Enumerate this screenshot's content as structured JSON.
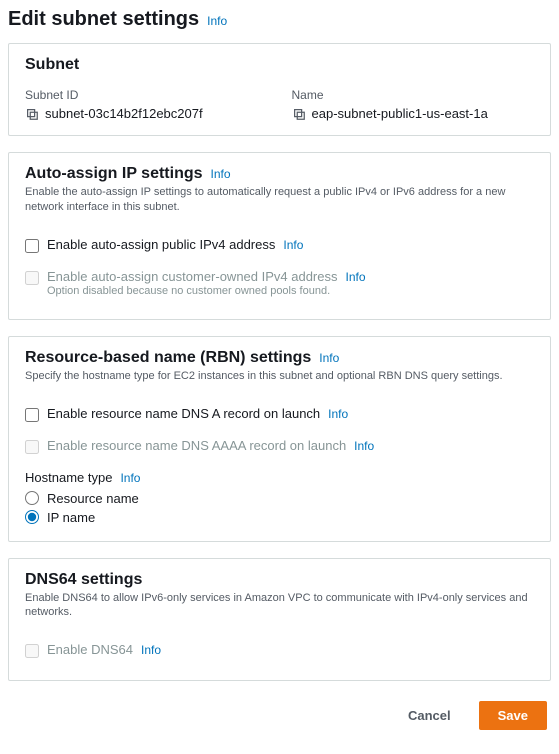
{
  "page": {
    "title": "Edit subnet settings",
    "info": "Info"
  },
  "subnet_panel": {
    "title": "Subnet",
    "fields": {
      "id": {
        "label": "Subnet ID",
        "value": "subnet-03c14b2f12ebc207f"
      },
      "name": {
        "label": "Name",
        "value": "eap-subnet-public1-us-east-1a"
      }
    }
  },
  "auto_assign": {
    "title": "Auto-assign IP settings",
    "info": "Info",
    "desc": "Enable the auto-assign IP settings to automatically request a public IPv4 or IPv6 address for a new network interface in this subnet.",
    "public_ipv4": {
      "label": "Enable auto-assign public IPv4 address",
      "info": "Info",
      "checked": false,
      "disabled": false
    },
    "customer_owned": {
      "label": "Enable auto-assign customer-owned IPv4 address",
      "info": "Info",
      "checked": false,
      "disabled": true,
      "helper": "Option disabled because no customer owned pools found."
    }
  },
  "rbn": {
    "title": "Resource-based name (RBN) settings",
    "info": "Info",
    "desc": "Specify the hostname type for EC2 instances in this subnet and optional RBN DNS query settings.",
    "dns_a": {
      "label": "Enable resource name DNS A record on launch",
      "info": "Info",
      "checked": false,
      "disabled": false
    },
    "dns_aaaa": {
      "label": "Enable resource name DNS AAAA record on launch",
      "info": "Info",
      "checked": false,
      "disabled": true
    },
    "hostname_type": {
      "label": "Hostname type",
      "info": "Info",
      "options": [
        {
          "value": "resource",
          "label": "Resource name"
        },
        {
          "value": "ip",
          "label": "IP name"
        }
      ],
      "selected": "ip"
    }
  },
  "dns64": {
    "title": "DNS64 settings",
    "desc": "Enable DNS64 to allow IPv6-only services in Amazon VPC to communicate with IPv4-only services and networks.",
    "enable": {
      "label": "Enable DNS64",
      "info": "Info",
      "checked": false,
      "disabled": true
    }
  },
  "footer": {
    "cancel": "Cancel",
    "save": "Save"
  }
}
